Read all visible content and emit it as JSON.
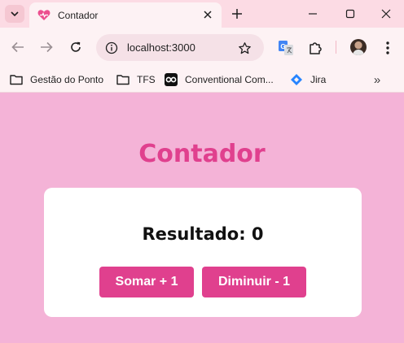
{
  "browser": {
    "tab": {
      "title": "Contador"
    },
    "address_bar": {
      "url": "localhost:3000"
    },
    "bookmarks": [
      {
        "label": "Gestão do Ponto",
        "icon": "folder-icon"
      },
      {
        "label": "TFS",
        "icon": "folder-icon"
      },
      {
        "label": "Conventional Com...",
        "icon": "conventional-commits-icon"
      },
      {
        "label": "Jira",
        "icon": "jira-icon"
      }
    ],
    "bookmarks_overflow": "»"
  },
  "page": {
    "title": "Contador",
    "result_text": "Resultado: 0",
    "buttons": {
      "add_label": "Somar + 1",
      "subtract_label": "Diminuir - 1"
    }
  },
  "colors": {
    "page_background": "#f4b3d7",
    "accent": "#e0408e",
    "card": "#ffffff",
    "chrome_frame": "#fcdbe4",
    "chrome_toolbar": "#fdf2f4"
  }
}
